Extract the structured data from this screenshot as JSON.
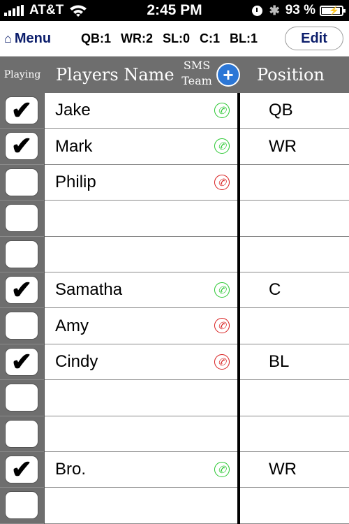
{
  "status": {
    "carrier": "AT&T",
    "time": "2:45 PM",
    "battery": "93 %",
    "battery_level": 0.93
  },
  "nav": {
    "menu_label": "Menu",
    "counts": [
      "QB:1",
      "WR:2",
      "SL:0",
      "C:1",
      "BL:1"
    ],
    "edit_label": "Edit"
  },
  "header": {
    "playing": "Playing",
    "players_name": "Players Name",
    "sms_line1": "SMS",
    "sms_line2": "Team",
    "add_icon": "+",
    "position": "Position"
  },
  "rows": [
    {
      "checked": true,
      "name": "Jake",
      "sms": "ok",
      "position": "QB"
    },
    {
      "checked": true,
      "name": "Mark",
      "sms": "ok",
      "position": "WR"
    },
    {
      "checked": false,
      "name": "Philip",
      "sms": "no",
      "position": ""
    },
    {
      "checked": false,
      "name": "",
      "sms": "",
      "position": ""
    },
    {
      "checked": false,
      "name": "",
      "sms": "",
      "position": ""
    },
    {
      "checked": true,
      "name": "Samatha",
      "sms": "ok",
      "position": "C"
    },
    {
      "checked": false,
      "name": "Amy",
      "sms": "no",
      "position": ""
    },
    {
      "checked": true,
      "name": "Cindy",
      "sms": "no",
      "position": "BL"
    },
    {
      "checked": false,
      "name": "",
      "sms": "",
      "position": ""
    },
    {
      "checked": false,
      "name": "",
      "sms": "",
      "position": ""
    },
    {
      "checked": true,
      "name": "Bro.",
      "sms": "ok",
      "position": "WR"
    },
    {
      "checked": false,
      "name": "",
      "sms": "",
      "position": ""
    }
  ],
  "colors": {
    "sms_ok": "#27c72f",
    "sms_no": "#d81c1c",
    "accent": "#0b1d6b",
    "header_bg": "#6e6e6e"
  },
  "icons": {
    "checkmark": "✔",
    "phone": "✆"
  }
}
